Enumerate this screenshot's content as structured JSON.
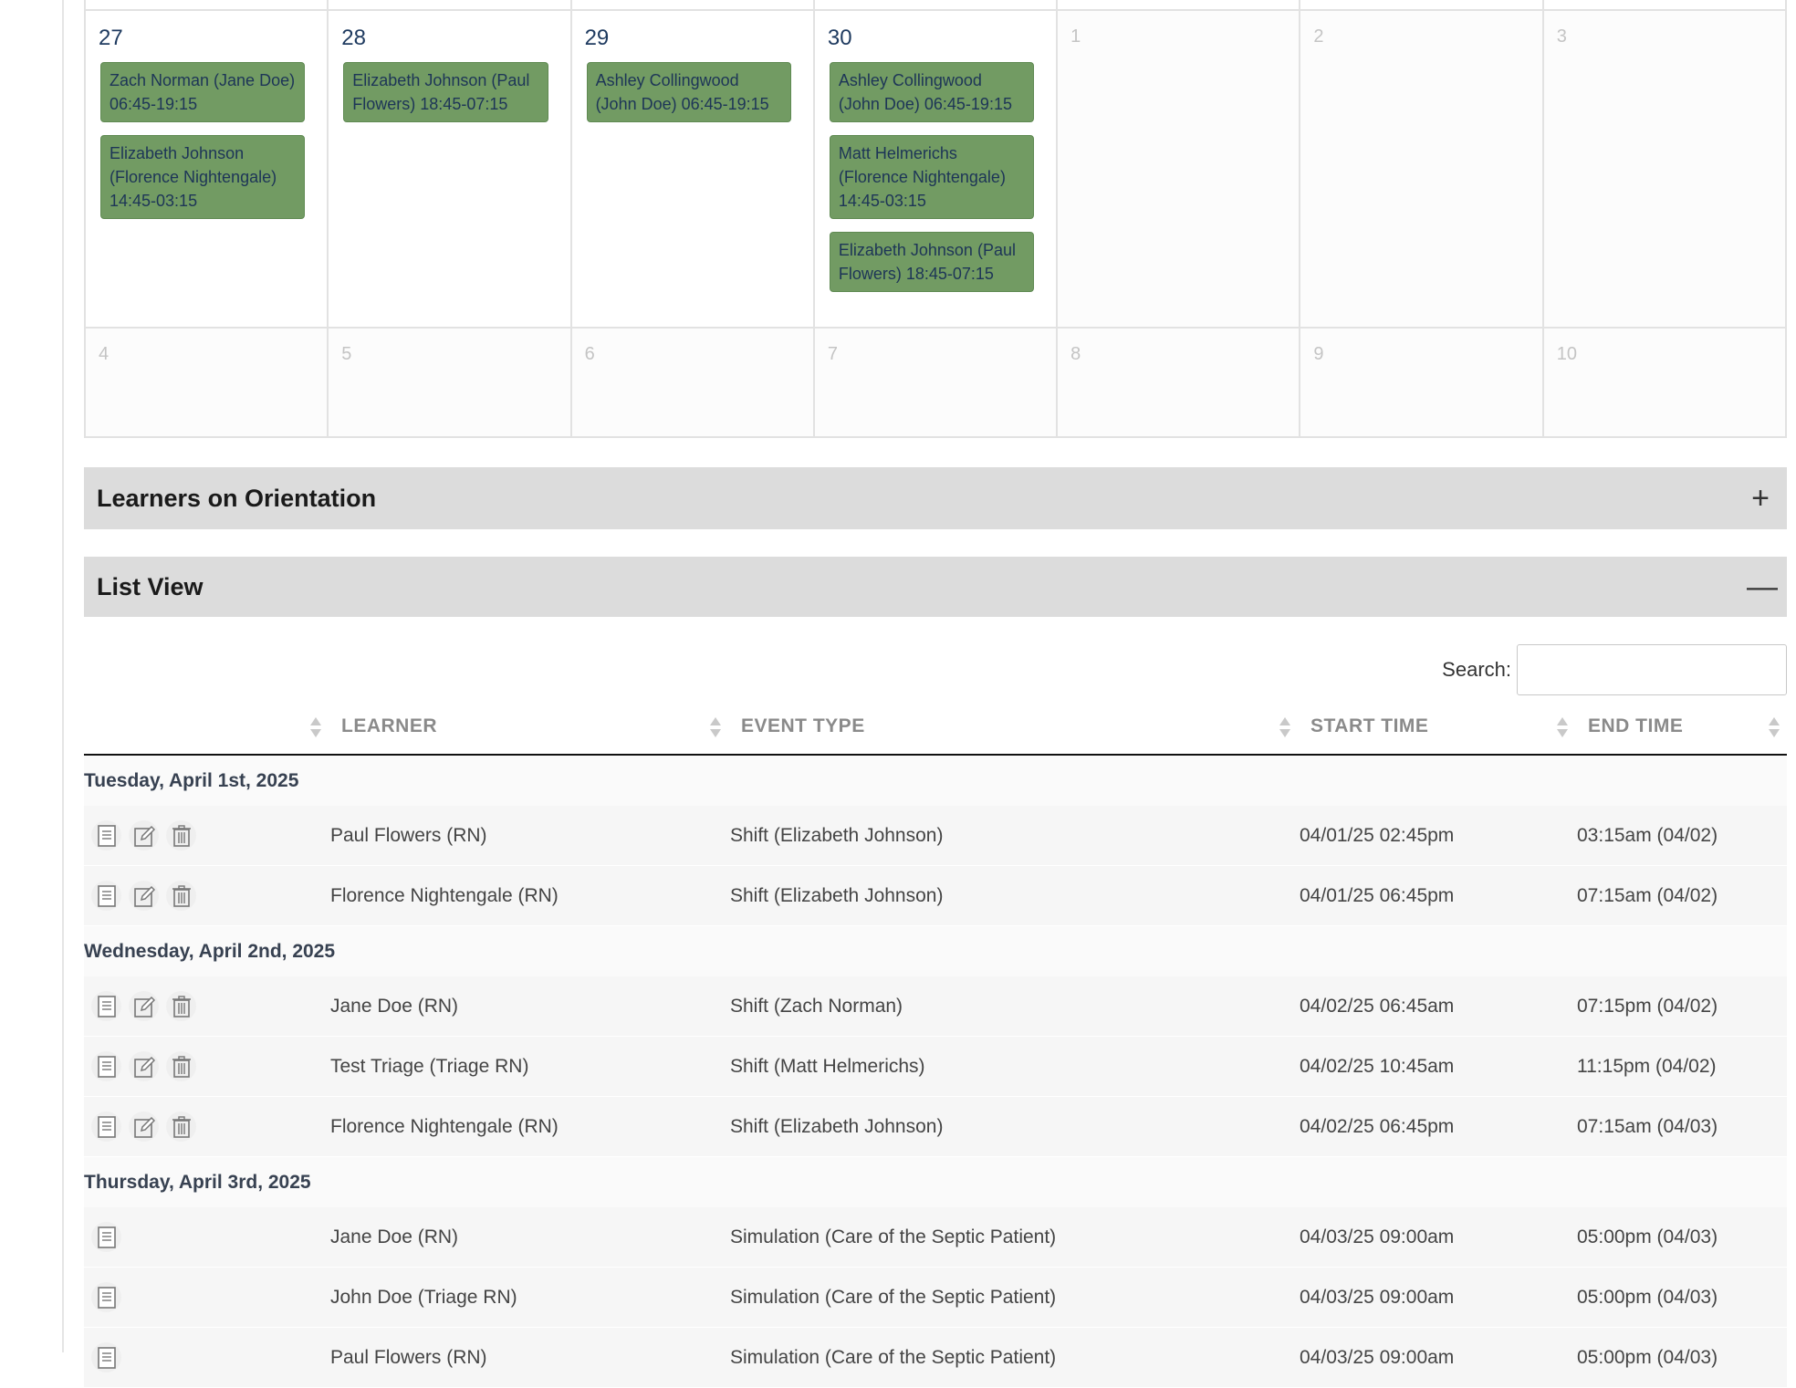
{
  "calendar": {
    "week1": [
      {
        "day": "27",
        "other": false,
        "events": [
          "Zach Norman (Jane Doe) 06:45-19:15",
          "Elizabeth Johnson (Florence Nightengale) 14:45-03:15"
        ]
      },
      {
        "day": "28",
        "other": false,
        "events": [
          "Elizabeth Johnson (Paul Flowers) 18:45-07:15"
        ]
      },
      {
        "day": "29",
        "other": false,
        "events": [
          "Ashley Collingwood (John Doe) 06:45-19:15"
        ]
      },
      {
        "day": "30",
        "other": false,
        "events": [
          "Ashley Collingwood (John Doe) 06:45-19:15",
          "Matt Helmerichs (Florence Nightengale) 14:45-03:15",
          "Elizabeth Johnson (Paul Flowers) 18:45-07:15"
        ]
      },
      {
        "day": "1",
        "other": true,
        "events": []
      },
      {
        "day": "2",
        "other": true,
        "events": []
      },
      {
        "day": "3",
        "other": true,
        "events": []
      }
    ],
    "week2": [
      {
        "day": "4"
      },
      {
        "day": "5"
      },
      {
        "day": "6"
      },
      {
        "day": "7"
      },
      {
        "day": "8"
      },
      {
        "day": "9"
      },
      {
        "day": "10"
      }
    ]
  },
  "accordions": {
    "orientation": {
      "title": "Learners on Orientation",
      "toggle": "+"
    },
    "list_view": {
      "title": "List View",
      "toggle": "—"
    }
  },
  "search": {
    "label": "Search:",
    "value": ""
  },
  "table": {
    "headers": [
      "",
      "LEARNER",
      "EVENT TYPE",
      "START TIME",
      "END TIME"
    ],
    "groups": [
      {
        "date": "Tuesday, April 1st, 2025",
        "rows": [
          {
            "actions": [
              "view",
              "edit",
              "delete"
            ],
            "learner": "Paul Flowers (RN)",
            "event": "Shift (Elizabeth Johnson)",
            "start": "04/01/25 02:45pm",
            "end": "03:15am (04/02)"
          },
          {
            "actions": [
              "view",
              "edit",
              "delete"
            ],
            "learner": "Florence Nightengale (RN)",
            "event": "Shift (Elizabeth Johnson)",
            "start": "04/01/25 06:45pm",
            "end": "07:15am (04/02)"
          }
        ]
      },
      {
        "date": "Wednesday, April 2nd, 2025",
        "rows": [
          {
            "actions": [
              "view",
              "edit",
              "delete"
            ],
            "learner": "Jane Doe (RN)",
            "event": "Shift (Zach Norman)",
            "start": "04/02/25 06:45am",
            "end": "07:15pm (04/02)"
          },
          {
            "actions": [
              "view",
              "edit",
              "delete"
            ],
            "learner": "Test Triage (Triage RN)",
            "event": "Shift (Matt Helmerichs)",
            "start": "04/02/25 10:45am",
            "end": "11:15pm (04/02)"
          },
          {
            "actions": [
              "view",
              "edit",
              "delete"
            ],
            "learner": "Florence Nightengale (RN)",
            "event": "Shift (Elizabeth Johnson)",
            "start": "04/02/25 06:45pm",
            "end": "07:15am (04/03)"
          }
        ]
      },
      {
        "date": "Thursday, April 3rd, 2025",
        "rows": [
          {
            "actions": [
              "view"
            ],
            "learner": "Jane Doe (RN)",
            "event": "Simulation (Care of the Septic Patient)",
            "start": "04/03/25 09:00am",
            "end": "05:00pm (04/03)"
          },
          {
            "actions": [
              "view"
            ],
            "learner": "John Doe (Triage RN)",
            "event": "Simulation (Care of the Septic Patient)",
            "start": "04/03/25 09:00am",
            "end": "05:00pm (04/03)"
          },
          {
            "actions": [
              "view"
            ],
            "learner": "Paul Flowers (RN)",
            "event": "Simulation (Care of the Septic Patient)",
            "start": "04/03/25 09:00am",
            "end": "05:00pm (04/03)"
          }
        ]
      }
    ]
  },
  "colors": {
    "event_bg": "#729b63",
    "event_text": "#1d3557",
    "accordion_bg": "#dcdcdc"
  },
  "icons": {
    "view": "document-icon",
    "edit": "edit-icon",
    "delete": "trash-icon"
  }
}
